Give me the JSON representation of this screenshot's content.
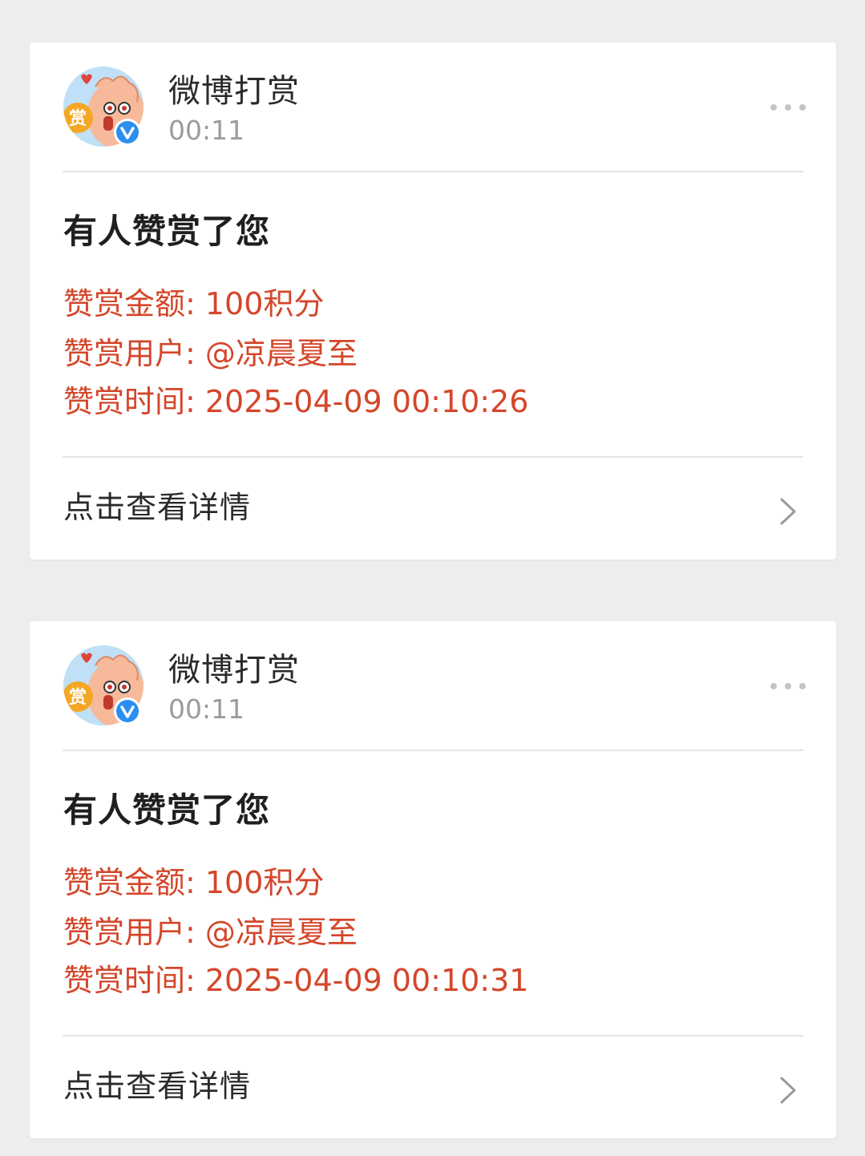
{
  "colors": {
    "page_background": "#ededed",
    "card_background": "#ffffff",
    "highlight_text": "#d4462a",
    "secondary_text": "#9b9b9b",
    "verified_badge": "#2a8ff0"
  },
  "messages": [
    {
      "sender": "微博打赏",
      "avatar_icon": "weibo-reward-mascot-icon",
      "verified_icon": "verified-v-icon",
      "time": "00:11",
      "more_icon": "more-dots-icon",
      "headline": "有人赞赏了您",
      "amount_line": "赞赏金额: 100积分",
      "user_line": "赞赏用户: @凉晨夏至",
      "datetime_line": "赞赏时间: 2025-04-09 00:10:26",
      "details_label": "点击查看详情",
      "details_icon": "chevron-right-icon"
    },
    {
      "sender": "微博打赏",
      "avatar_icon": "weibo-reward-mascot-icon",
      "verified_icon": "verified-v-icon",
      "time": "00:11",
      "more_icon": "more-dots-icon",
      "headline": "有人赞赏了您",
      "amount_line": "赞赏金额: 100积分",
      "user_line": "赞赏用户: @凉晨夏至",
      "datetime_line": "赞赏时间: 2025-04-09 00:10:31",
      "details_label": "点击查看详情",
      "details_icon": "chevron-right-icon"
    }
  ]
}
